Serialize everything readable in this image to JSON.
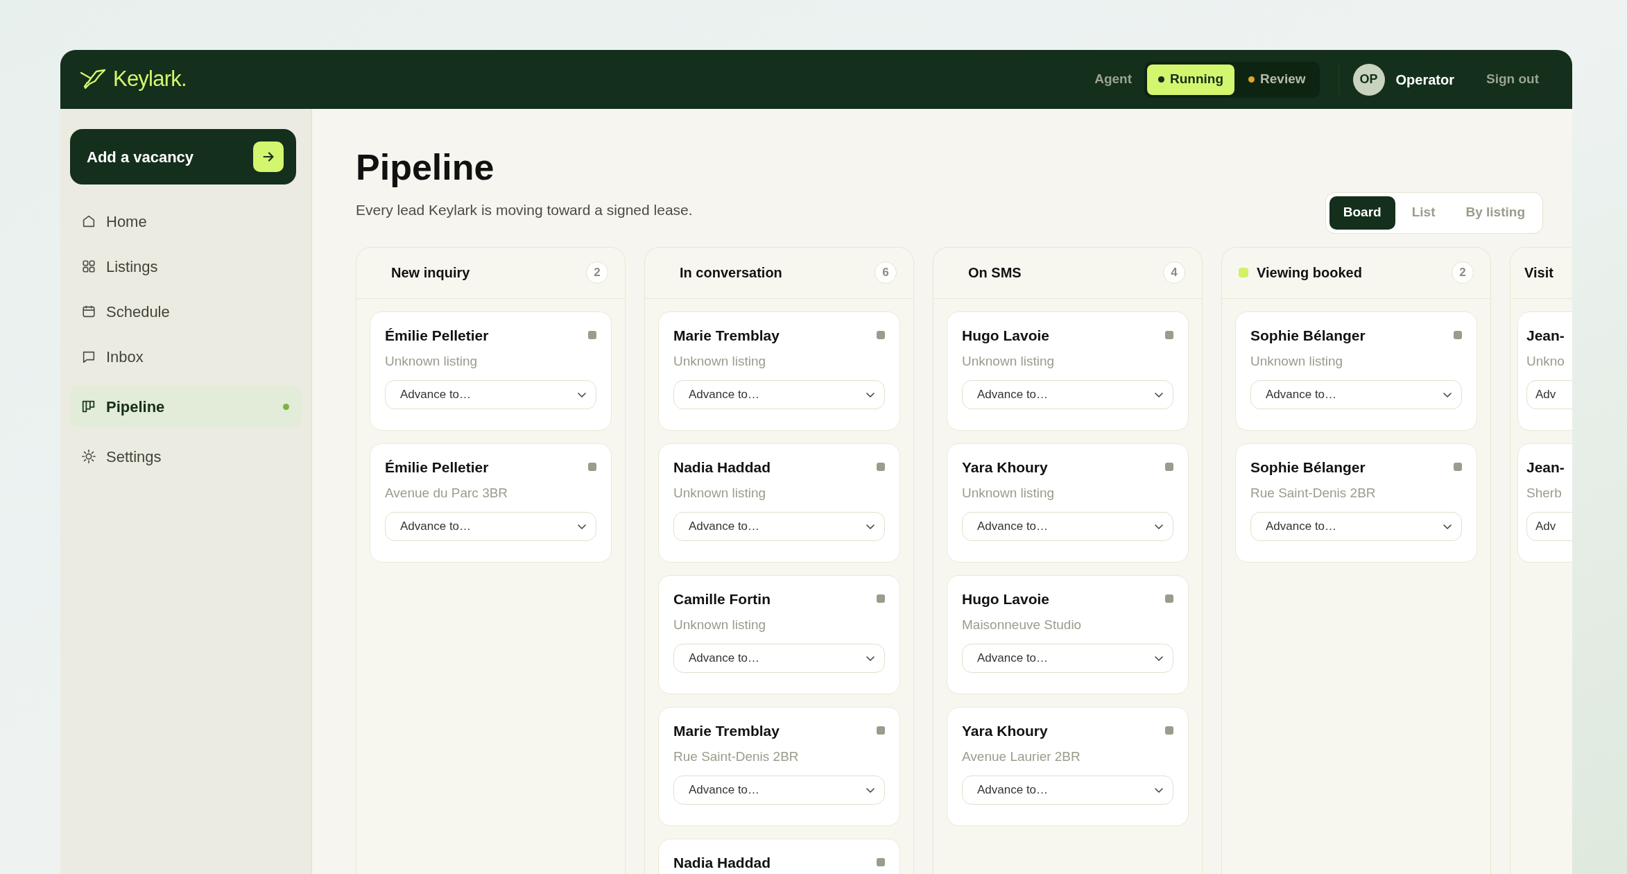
{
  "brand": {
    "name": "Keylark."
  },
  "header": {
    "agent_label": "Agent",
    "agent_modes": [
      {
        "label": "Running",
        "selected": true
      },
      {
        "label": "Review",
        "selected": false
      }
    ],
    "avatar": "OP",
    "user": "Operator",
    "sign_out": "Sign out"
  },
  "sidebar": {
    "cta": "Add a vacancy",
    "items": [
      {
        "label": "Home",
        "selected": false
      },
      {
        "label": "Listings",
        "selected": false
      },
      {
        "label": "Schedule",
        "selected": false
      },
      {
        "label": "Inbox",
        "selected": false
      },
      {
        "label": "Pipeline",
        "selected": true
      },
      {
        "label": "Settings",
        "selected": false
      }
    ]
  },
  "page": {
    "title": "Pipeline",
    "subtitle": "Every lead Keylark is moving toward a signed lease.",
    "views": [
      {
        "label": "Board",
        "selected": true
      },
      {
        "label": "List",
        "selected": false
      },
      {
        "label": "By listing",
        "selected": false
      }
    ]
  },
  "columns": [
    {
      "title": "New inquiry",
      "count": "2",
      "cards": [
        {
          "name": "Émilie Pelletier",
          "listing": "Unknown listing",
          "action": "Advance to…"
        },
        {
          "name": "Émilie Pelletier",
          "listing": "Avenue du Parc 3BR",
          "action": "Advance to…"
        }
      ]
    },
    {
      "title": "In conversation",
      "count": "6",
      "cards": [
        {
          "name": "Marie Tremblay",
          "listing": "Unknown listing",
          "action": "Advance to…"
        },
        {
          "name": "Nadia Haddad",
          "listing": "Unknown listing",
          "action": "Advance to…"
        },
        {
          "name": "Camille Fortin",
          "listing": "Unknown listing",
          "action": "Advance to…"
        },
        {
          "name": "Marie Tremblay",
          "listing": "Rue Saint-Denis 2BR",
          "action": "Advance to…"
        },
        {
          "name": "Nadia Haddad"
        }
      ]
    },
    {
      "title": "On SMS",
      "count": "4",
      "cards": [
        {
          "name": "Hugo Lavoie",
          "listing": "Unknown listing",
          "action": "Advance to…"
        },
        {
          "name": "Yara Khoury",
          "listing": "Unknown listing",
          "action": "Advance to…"
        },
        {
          "name": "Hugo Lavoie",
          "listing": "Maisonneuve Studio",
          "action": "Advance to…"
        },
        {
          "name": "Yara Khoury",
          "listing": "Avenue Laurier 2BR",
          "action": "Advance to…"
        }
      ]
    },
    {
      "title": "Viewing booked",
      "count": "2",
      "color": "#d4ef6a",
      "cards": [
        {
          "name": "Sophie Bélanger",
          "listing": "Unknown listing",
          "action": "Advance to…"
        },
        {
          "name": "Sophie Bélanger",
          "listing": "Rue Saint-Denis 2BR",
          "action": "Advance to…"
        }
      ]
    },
    {
      "title": "Visit",
      "cards": [
        {
          "name": "Jean-",
          "listing": "Unkno",
          "action": "Adv"
        },
        {
          "name": "Jean-",
          "listing": "Sherb",
          "action": "Adv"
        }
      ]
    }
  ]
}
